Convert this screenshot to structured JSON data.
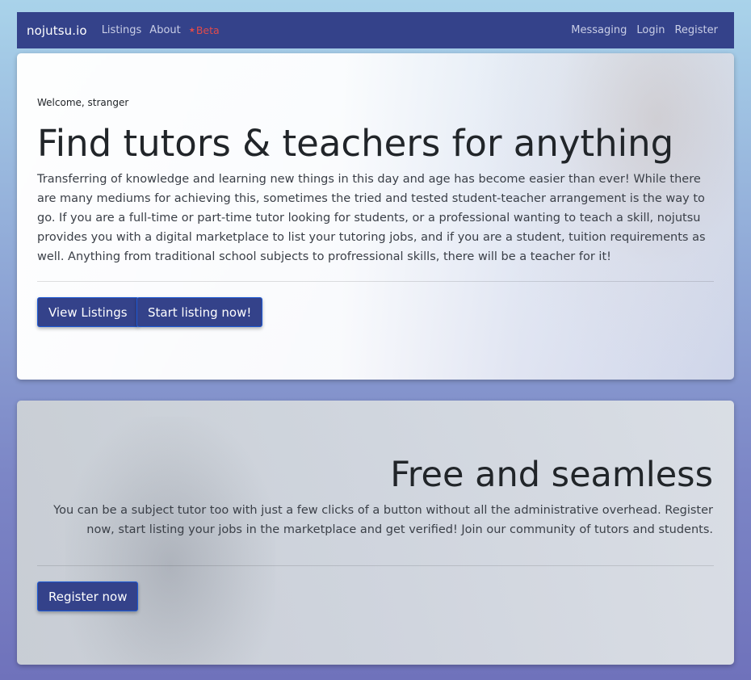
{
  "nav": {
    "brand": "nojutsu.io",
    "left_links": [
      "Listings",
      "About"
    ],
    "beta_label": "Beta",
    "beta_icon": "star-icon",
    "right_links": [
      "Messaging",
      "Login",
      "Register"
    ]
  },
  "hero": {
    "welcome": "Welcome, stranger",
    "title": "Find tutors & teachers for anything",
    "description": "Transferring of knowledge and learning new things in this day and age has become easier than ever! While there are many mediums for achieving this, sometimes the tried and tested student-teacher arrangement is the way to go. If you are a full-time or part-time tutor looking for students, or a professional wanting to teach a skill, nojutsu provides you with a digital marketplace to list your tutoring jobs, and if you are a student, tuition requirements as well. Anything from traditional school subjects to profressional skills, there will be a teacher for it!",
    "view_listings_label": "View Listings",
    "start_listing_label": "Start listing now!"
  },
  "feature": {
    "title": "Free and seamless",
    "description": "You can be a subject tutor too with just a few clicks of a button without all the administrative overhead. Register now, start listing your jobs in the marketplace and get verified! Join our community of tutors and students.",
    "register_label": "Register now"
  },
  "colors": {
    "navbar": "#34428a",
    "button": "#34428a",
    "button_border": "#1e5bd6",
    "beta": "#e14b4b"
  }
}
